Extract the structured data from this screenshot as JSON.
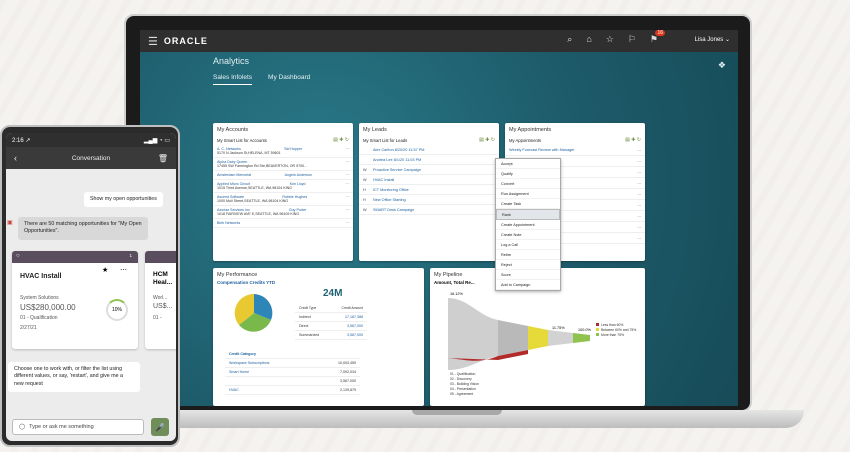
{
  "topbar": {
    "brand": "ORACLE",
    "user": "Lisa Jones ⌄",
    "badge": "16"
  },
  "app": {
    "name": "Analytics",
    "tabs": [
      "Sales Infolets",
      "My Dashboard"
    ]
  },
  "accounts": {
    "title": "My Accounts",
    "list": "My Smart List for Accounts",
    "rows": [
      {
        "name": "A. C. Networks",
        "addr": "5170 N Jackson St,HELENA, MT 59601",
        "contact": "Sid Hopper",
        "contact_addr": "5170 N Jackson St,HELENA, MT 59601"
      },
      {
        "name": "Alpha Dairy Queen",
        "addr": "17455 SW Farmington Rd Ste,BEAVERTON, OR 9700...",
        "contact": "",
        "contact_addr": ""
      },
      {
        "name": "Amsterdam Memorial",
        "addr": "",
        "contact": "Angelo Anderson",
        "contact_addr": ""
      },
      {
        "name": "Applied Micro Circuit",
        "addr": "1015 Third Avenue,SEATTLE, WA 98104 KING",
        "contact": "Kim Lloyd",
        "contact_addr": ""
      },
      {
        "name": "Ascend Software",
        "addr": "1000 Mull Street,SEATTLE, WA 98104 KING",
        "contact": "Robbie Hughes",
        "contact_addr": ""
      },
      {
        "name": "Azurian Services Inc",
        "addr": "1018 FAIRVIEW AVE E,SEATTLE, WA 98109 KING",
        "contact": "Guy Porter",
        "contact_addr": "1018 FAIRVIEW AVE E,SEATTLE, WA 98109 KING"
      },
      {
        "name": "Bieb Networks",
        "addr": "",
        "contact": "",
        "contact_addr": ""
      }
    ]
  },
  "leads": {
    "title": "My Leads",
    "list": "My Smart List for Leads",
    "rows": [
      {
        "w": "",
        "name": "Alex Carlton 8/20/20 11:57 PM"
      },
      {
        "w": "",
        "name": "Andrea Lee 8/1/20 11:03 PM"
      },
      {
        "w": "W",
        "name": "Proactive Service Campaign"
      },
      {
        "w": "W",
        "name": "HVAC Install"
      },
      {
        "w": "H",
        "name": "ICT Monitoring Office"
      },
      {
        "w": "H",
        "name": "New Office Starting"
      },
      {
        "w": "W",
        "name": "SMART Desk Campaign"
      }
    ]
  },
  "menu": [
    "Accept",
    "Qualify",
    "Convert",
    "Run Assignment",
    "Create Task",
    "Rank",
    "Create Appointment",
    "Create Note",
    "Log a Call",
    "Retire",
    "Reject",
    "Score",
    "Add to Campaign"
  ],
  "appointments": {
    "title": "My Appointments",
    "list": "My Appointments",
    "rows": [
      "Weekly Forecast Review with Manager",
      "...utes",
      "",
      "...eview with Manager",
      "...eview with Manager",
      "04/29/2020",
      "04/30/2020",
      "05/01/2020",
      "05/01/2020"
    ]
  },
  "performance": {
    "title": "My Performance",
    "subtitle": "Compensation Credits YTD",
    "big": "24M",
    "credit_head": [
      "Credit Type",
      "Credit Amount"
    ],
    "credits": [
      [
        "Indirect",
        "17,187,388"
      ],
      [
        "Direct",
        "3,567,000"
      ],
      [
        "Summarized",
        "3,567,000"
      ]
    ],
    "cat_head": "Credit Category",
    "cats": [
      [
        "Workspace Subscriptions",
        "10,003,459"
      ],
      [
        "Smart Home",
        "7,092,034"
      ],
      [
        "",
        "3,567,000"
      ],
      [
        "HVAC",
        "2,139,879"
      ]
    ]
  },
  "pipeline": {
    "title": "My Pipeline",
    "subtitle": "Amount, Total Re...",
    "pct_top": "16.12%",
    "pct_mid": "11.75%",
    "pct_right": "100.0%",
    "stages": [
      "01 - Qualification",
      "02 - Discovery",
      "03 - Building Vision",
      "04 - Presentation",
      "05 - Agreement"
    ],
    "legend": [
      "Less than 60%",
      "Between 60% and 75%",
      "More than 75%"
    ]
  },
  "phone": {
    "time": "2:16 ↗",
    "title": "Conversation",
    "user_msg": "Show my open opportunities",
    "bot_msg": "There are 50 matching opportunities for \"My Open Opportunities\".",
    "card1": {
      "title": "HVAC Install",
      "org": "System Solutions",
      "amount": "US$280,000.00",
      "stage": "01 - Qualification",
      "date": "2/27/21",
      "pct": "10%",
      "count": "1"
    },
    "card2": {
      "title": "HCM Heal...",
      "org": "Worl...",
      "amount": "US$...",
      "stage": "01 -"
    },
    "help": "Choose one to work with, or filter the list using different values, or say, 'restart', and give me a new request",
    "input_placeholder": "Type or ask me something"
  },
  "colors": {
    "accent": "#1a5e9e",
    "teal": "#1f6272",
    "phone_card": "#5a4e5e"
  }
}
